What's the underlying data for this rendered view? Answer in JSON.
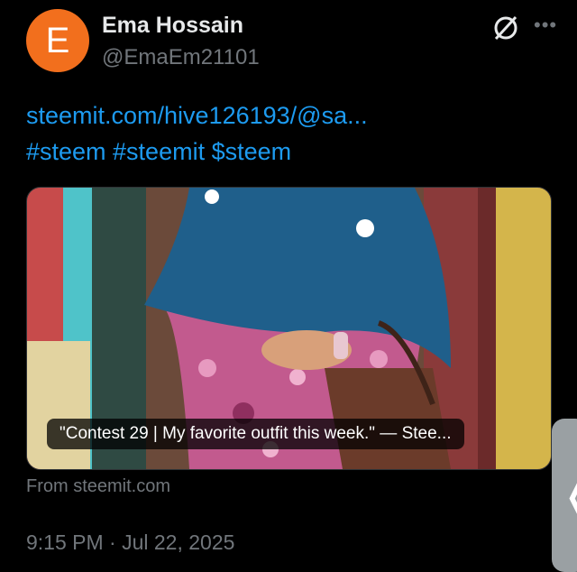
{
  "post": {
    "avatar_initial": "E",
    "author_name": "Ema Hossain",
    "author_handle": "@EmaEm21101",
    "link_text": "steemit.com/hive126193/@sa...",
    "hashtags": "#steem #steemit $steem",
    "card_caption": "\"Contest 29 | My favorite outfit this week.\" — Stee...",
    "card_source": "From steemit.com",
    "timestamp": "9:15 PM · Jul 22, 2025"
  },
  "icons": {
    "grok": "grok-icon",
    "more": "more-options-icon",
    "edge_panel": "chevron-left-icon"
  },
  "colors": {
    "background": "#000000",
    "link": "#1d9bf0",
    "muted": "#71767b",
    "avatar": "#f26f1d"
  }
}
